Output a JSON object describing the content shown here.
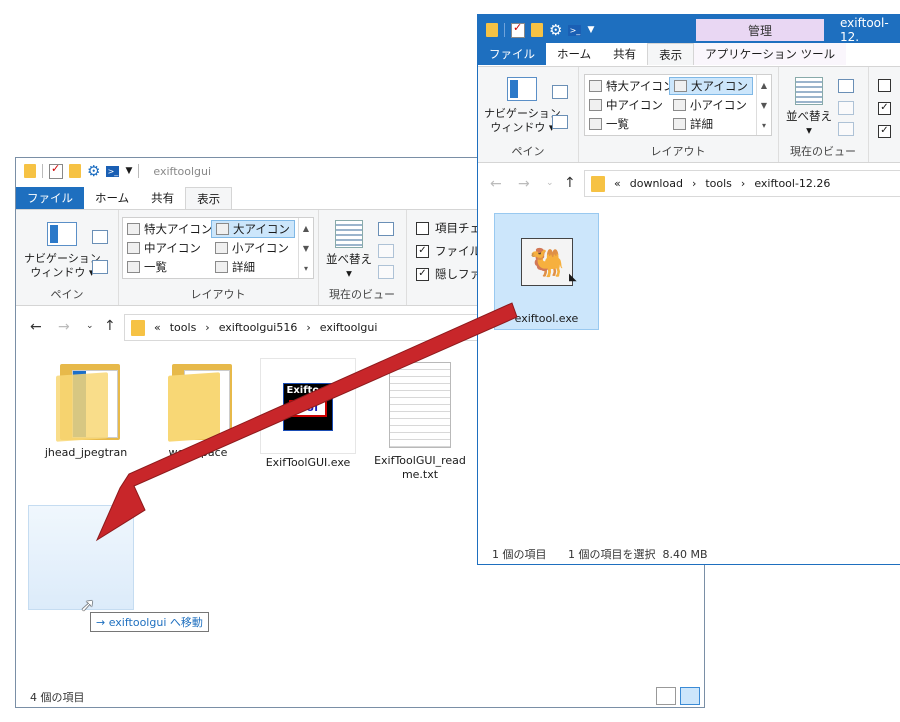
{
  "left_window": {
    "title": "exiftoolgui",
    "tabs": [
      "ファイル",
      "ホーム",
      "共有",
      "表示"
    ],
    "ribbon": {
      "pane_group": {
        "nav_pane_line1": "ナビゲーション",
        "nav_pane_line2": "ウィンドウ ▾",
        "label": "ペイン"
      },
      "layout_group": {
        "items": [
          "特大アイコン",
          "大アイコン",
          "中アイコン",
          "小アイコン",
          "一覧",
          "詳細"
        ],
        "label": "レイアウト"
      },
      "view_group": {
        "sort_line1": "並べ替え",
        "sort_line2": "▾",
        "label": "現在のビュー"
      },
      "checkboxes": [
        {
          "label": "項目チェ",
          "checked": false
        },
        {
          "label": "ファイル名",
          "checked": true
        },
        {
          "label": "隠しファイ",
          "checked": true
        }
      ]
    },
    "address": {
      "prefix": "«",
      "crumbs": [
        "tools",
        "exiftoolgui516",
        "exiftoolgui"
      ]
    },
    "items": [
      {
        "label": "jhead_jpegtran",
        "kind": "folder"
      },
      {
        "label": "workspace",
        "kind": "folder"
      },
      {
        "label": "ExifToolGUI.exe",
        "kind": "exe",
        "icon_text_1": "Exiftool",
        "icon_text_2": "GUI"
      },
      {
        "label": "ExifToolGUI_readme.txt",
        "kind": "txt"
      }
    ],
    "status": "4 個の項目"
  },
  "right_window": {
    "contextual_tab": "管理",
    "title": "exiftool-12.",
    "tabs": [
      "ファイル",
      "ホーム",
      "共有",
      "表示",
      "アプリケーション ツール"
    ],
    "ribbon": {
      "pane_group": {
        "nav_pane_line1": "ナビゲーション",
        "nav_pane_line2": "ウィンドウ ▾",
        "label": "ペイン"
      },
      "layout_group": {
        "items": [
          "特大アイコン",
          "大アイコン",
          "中アイコン",
          "小アイコン",
          "一覧",
          "詳細"
        ],
        "label": "レイアウト"
      },
      "view_group": {
        "sort_line1": "並べ替え",
        "sort_line2": "▾",
        "label": "現在のビュー"
      }
    },
    "address": {
      "prefix": "«",
      "crumbs": [
        "download",
        "tools",
        "exiftool-12.26"
      ]
    },
    "items": [
      {
        "label": "exiftool.exe",
        "kind": "exe"
      }
    ],
    "status_count": "1 個の項目",
    "status_selection": "1 個の項目を選択  8.40 MB"
  },
  "drag": {
    "tooltip_arrow": "→",
    "tooltip_text": "exiftoolgui へ移動"
  },
  "colors": {
    "accent": "#1e6fbf",
    "arrow": "#c8262a",
    "selection": "#cce6fb"
  }
}
